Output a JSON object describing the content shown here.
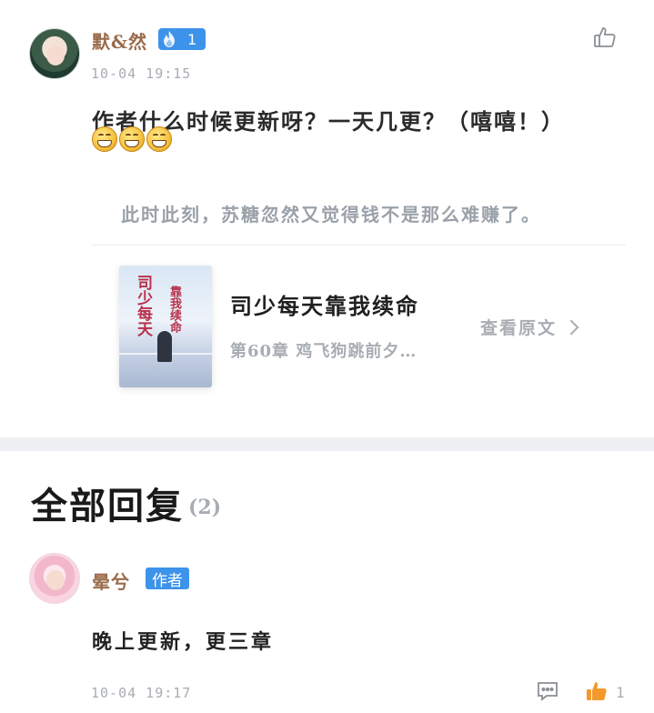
{
  "comment": {
    "username": "默&然",
    "fire_level": "1",
    "time": "10-04 19:15",
    "text": "作者什么时候更新呀？一天几更？（嘻嘻！）",
    "emoji_icons": [
      "grin-emoji",
      "grin-emoji",
      "grin-emoji"
    ],
    "quote": "此时此刻，苏糖忽然又觉得钱不是那么难赚了。"
  },
  "book": {
    "title": "司少每天靠我续命",
    "chapter": "第60章 鸡飞狗跳前夕…",
    "view_original": "查看原文",
    "cover_text_main": "司少每天",
    "cover_text_side": "靠我续命"
  },
  "replies": {
    "title": "全部回复",
    "count": "(2)",
    "items": [
      {
        "username": "晕兮",
        "badge": "作者",
        "text": "晚上更新，更三章",
        "time": "10-04 19:17",
        "like_count": "1"
      }
    ]
  },
  "colors": {
    "accent_blue": "#3d93ea",
    "username_brown": "#9a6b4b",
    "muted_gray": "#a8adb3",
    "like_orange": "#f39a2b"
  }
}
